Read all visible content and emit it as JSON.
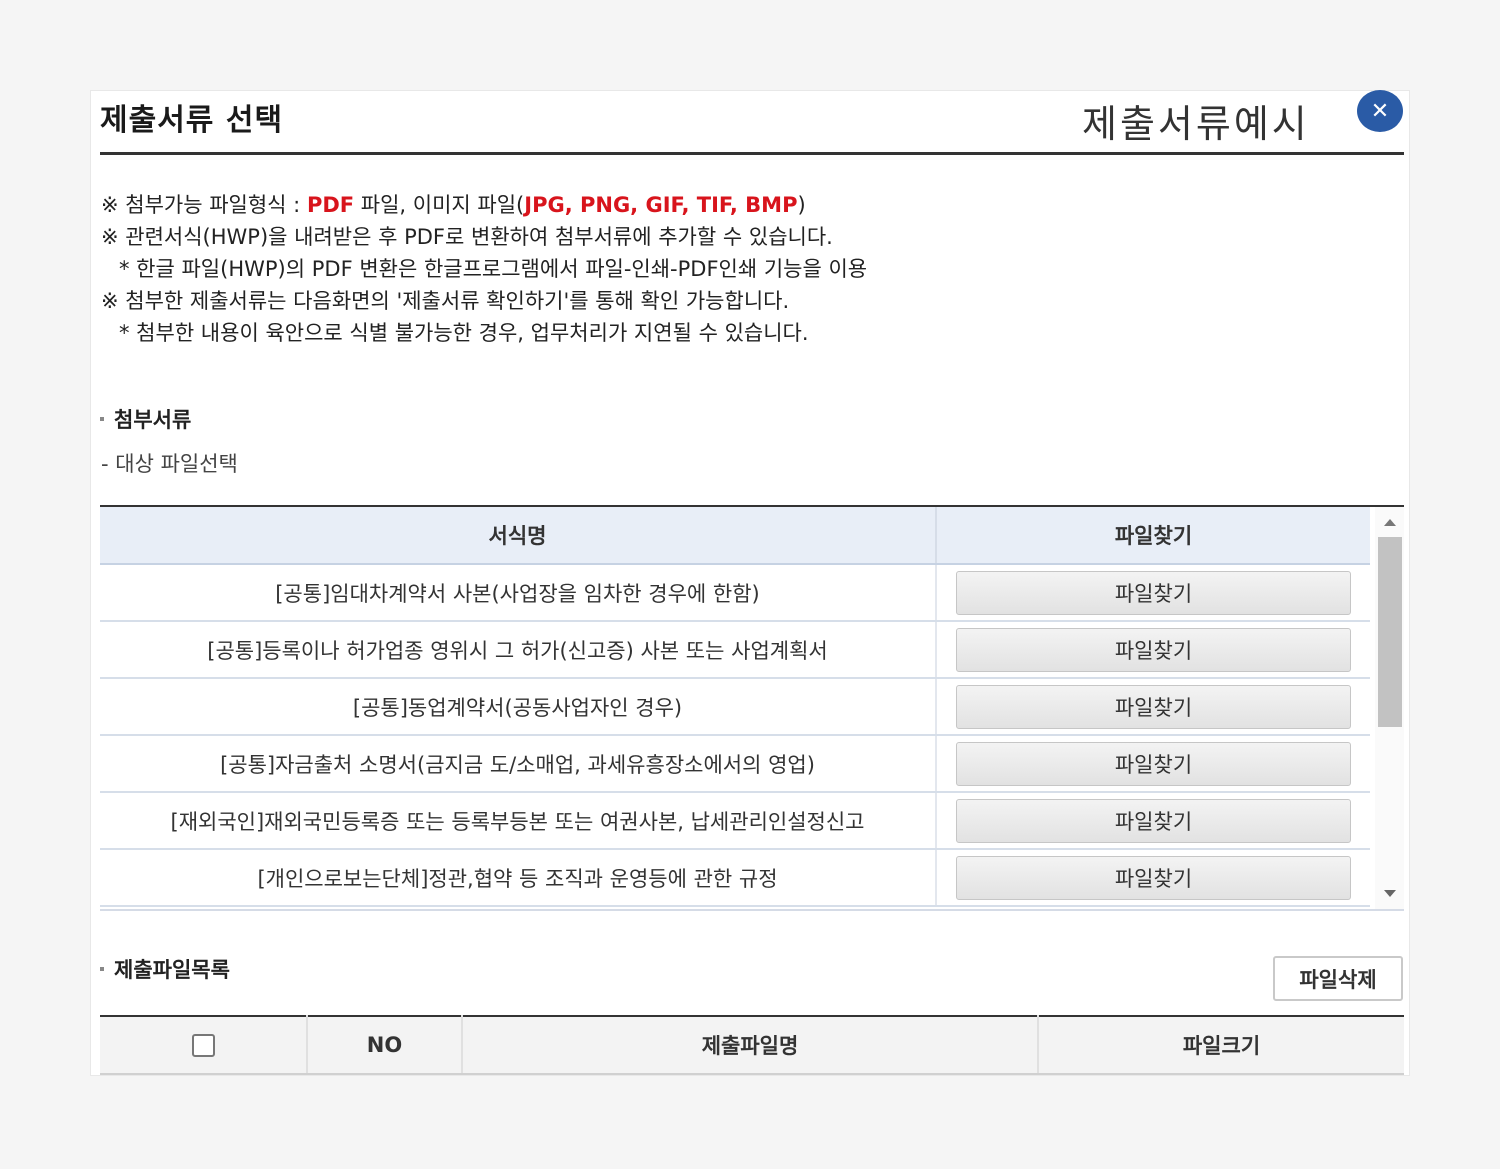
{
  "header": {
    "title": "제출서류 선택",
    "example_link": "제출서류예시",
    "close_symbol": "✕"
  },
  "notices": {
    "line1_prefix": "※ 첨부가능 파일형식 : ",
    "line1_pdf": "PDF",
    "line1_mid": " 파일, 이미지 파일(",
    "line1_types": "JPG, PNG, GIF, TIF, BMP",
    "line1_suffix": ")",
    "line2": "※ 관련서식(HWP)을 내려받은 후 PDF로 변환하여 첨부서류에 추가할 수 있습니다.",
    "line3": "* 한글 파일(HWP)의 PDF 변환은 한글프로그램에서 파일-인쇄-PDF인쇄 기능을 이용",
    "line4": "※ 첨부한 제출서류는 다음화면의 '제출서류 확인하기'를 통해 확인 가능합니다.",
    "line5": "* 첨부한 내용이 육안으로 식별 불가능한 경우, 업무처리가 지연될 수 있습니다."
  },
  "attach_section": {
    "title": "첨부서류",
    "subtitle": "- 대상 파일선택",
    "col_form_name": "서식명",
    "col_find_file": "파일찾기",
    "rows": [
      {
        "name": "[공통]임대차계약서 사본(사업장을 임차한 경우에 한함)",
        "button": "파일찾기"
      },
      {
        "name": "[공통]등록이나 허가업종 영위시 그 허가(신고증) 사본 또는 사업계획서",
        "button": "파일찾기"
      },
      {
        "name": "[공통]동업계약서(공동사업자인 경우)",
        "button": "파일찾기"
      },
      {
        "name": "[공통]자금출처 소명서(금지금 도/소매업, 과세유흥장소에서의 영업)",
        "button": "파일찾기"
      },
      {
        "name": "[재외국인]재외국민등록증 또는 등록부등본 또는 여권사본, 납세관리인설정신고",
        "button": "파일찾기"
      },
      {
        "name": "[개인으로보는단체]정관,협약 등 조직과 운영등에 관한 규정",
        "button": "파일찾기"
      }
    ]
  },
  "submit_section": {
    "title": "제출파일목록",
    "delete_button": "파일삭제",
    "col_no": "NO",
    "col_file_name": "제출파일명",
    "col_file_size": "파일크기"
  }
}
